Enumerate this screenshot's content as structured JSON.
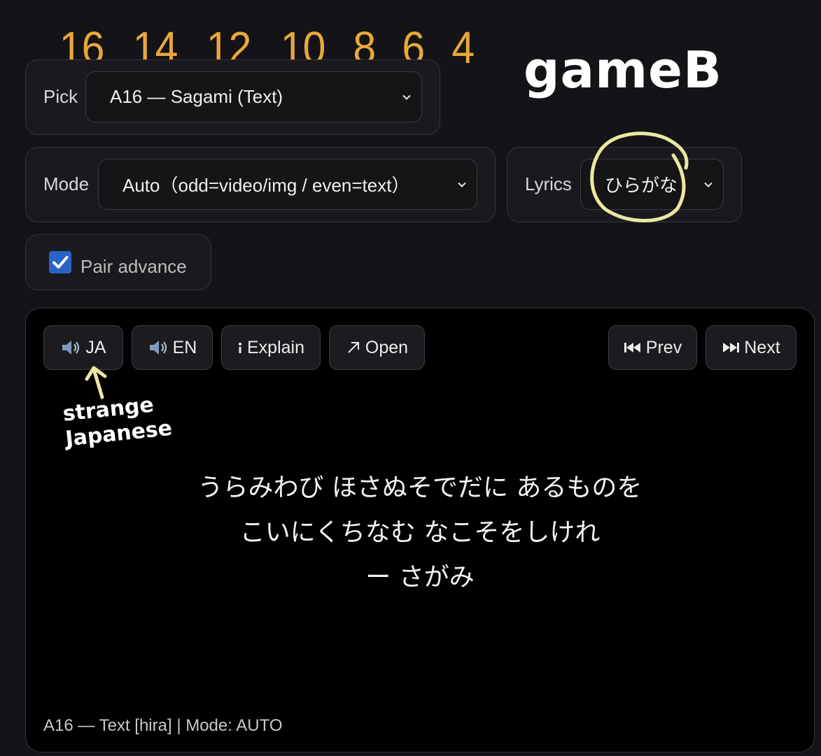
{
  "overlay": {
    "numbers": [
      "16",
      "14",
      "12",
      "10",
      "8",
      "6",
      "4"
    ],
    "title": "gameB",
    "annotation_line1": "strange",
    "annotation_line2": "Japanese",
    "number_color": "#e8a83a",
    "circle_color": "#ece7a0"
  },
  "pick": {
    "label": "Pick",
    "value": "A16 — Sagami (Text)"
  },
  "mode": {
    "label": "Mode",
    "value": "Auto（odd=video/img / even=text）"
  },
  "lyrics_select": {
    "label": "Lyrics",
    "value": "ひらがな"
  },
  "pair_advance": {
    "label": "Pair advance",
    "checked": true
  },
  "toolbar": {
    "ja": "JA",
    "en": "EN",
    "explain": "Explain",
    "open": "Open",
    "prev": "Prev",
    "next": "Next"
  },
  "poem": {
    "line1": "うらみわび ほさぬそでだに あるものを",
    "line2": "こいにくちなむ なこそをしけれ",
    "line3": "ー さがみ"
  },
  "status": "A16 — Text [hira] | Mode: AUTO",
  "colors": {
    "accent": "#2a63c6",
    "background": "#141418"
  }
}
